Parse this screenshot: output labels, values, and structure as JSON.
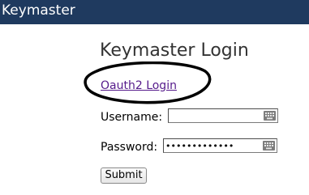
{
  "header": {
    "app_title": "Keymaster",
    "bg_color": "#1f3a5f"
  },
  "login": {
    "title": "Keymaster Login",
    "oauth_link": "Oauth2 Login",
    "username_label": "Username:",
    "username_value": "",
    "password_label": "Password:",
    "password_value": "•••••••••••••",
    "submit_label": "Submit"
  },
  "annotation": {
    "type": "hand-drawn ellipse",
    "color": "#000000"
  },
  "icons": {
    "input_helper": "keyboard-icon"
  }
}
